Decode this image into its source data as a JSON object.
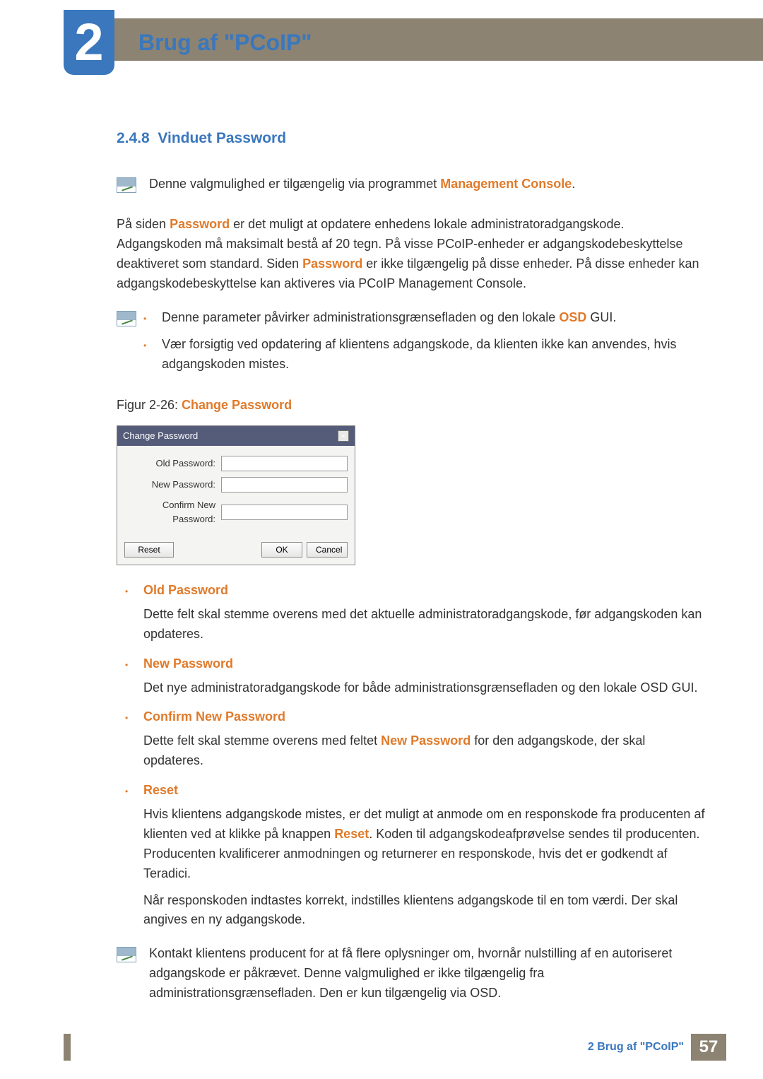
{
  "chapter": {
    "number": "2",
    "title": "Brug af \"PCoIP\""
  },
  "section": {
    "number": "2.4.8",
    "title": "Vinduet Password"
  },
  "intro_note": {
    "pre": "Denne valgmulighed er tilgængelig via programmet ",
    "hl": "Management Console",
    "post": "."
  },
  "para1": {
    "a": "På siden ",
    "hl1": "Password",
    "b": " er det muligt at opdatere enhedens lokale administratoradgangskode. Adgangskoden må maksimalt bestå af 20 tegn. På visse PCoIP-enheder er adgangskodebeskyttelse deaktiveret som standard. Siden ",
    "hl2": "Password",
    "c": " er ikke tilgængelig på disse enheder. På disse enheder kan adgangskodebeskyttelse kan aktiveres via PCoIP Management Console."
  },
  "note2": {
    "items": [
      {
        "a": "Denne parameter påvirker administrationsgrænsefladen og den lokale ",
        "hl": "OSD",
        "b": " GUI."
      },
      {
        "a": "Vær forsigtig ved opdatering af klientens adgangskode, da klienten ikke kan anvendes, hvis adgangskoden mistes.",
        "hl": "",
        "b": ""
      }
    ]
  },
  "figure": {
    "label": "Figur 2-26: ",
    "name": "Change Password"
  },
  "dialog": {
    "title": "Change Password",
    "close": "×",
    "fields": [
      {
        "label": "Old Password:"
      },
      {
        "label": "New Password:"
      },
      {
        "label": "Confirm New Password:"
      }
    ],
    "reset": "Reset",
    "ok": "OK",
    "cancel": "Cancel"
  },
  "defs": [
    {
      "term": "Old Password",
      "desc": [
        {
          "text": "Dette felt skal stemme overens med det aktuelle administratoradgangskode, før adgangskoden kan opdateres."
        }
      ]
    },
    {
      "term": "New Password",
      "desc": [
        {
          "text": "Det nye administratoradgangskode for både administrationsgrænsefladen og den lokale OSD GUI."
        }
      ]
    },
    {
      "term": "Confirm New Password",
      "desc": [
        {
          "pre": "Dette felt skal stemme overens med feltet ",
          "hl": "New Password",
          "post": " for den adgangskode, der skal opdateres."
        }
      ]
    },
    {
      "term": "Reset",
      "desc": [
        {
          "pre": "Hvis klientens adgangskode mistes, er det muligt at anmode om en responskode fra producenten af klienten ved at klikke på knappen ",
          "hl": "Reset",
          "post": ". Koden til adgangskodeafprøvelse sendes til producenten. Producenten kvalificerer anmodningen og returnerer en responskode, hvis det er godkendt af Teradici."
        },
        {
          "text": "Når responskoden indtastes korrekt, indstilles klientens adgangskode til en tom værdi. Der skal angives en ny adgangskode."
        }
      ]
    }
  ],
  "note3": "Kontakt klientens producent for at få flere oplysninger om, hvornår nulstilling af en autoriseret adgangskode er påkrævet. Denne valgmulighed er ikke tilgængelig fra administrationsgrænsefladen. Den er kun tilgængelig via OSD.",
  "footer": {
    "label": "2 Brug af \"PCoIP\"",
    "page": "57"
  }
}
